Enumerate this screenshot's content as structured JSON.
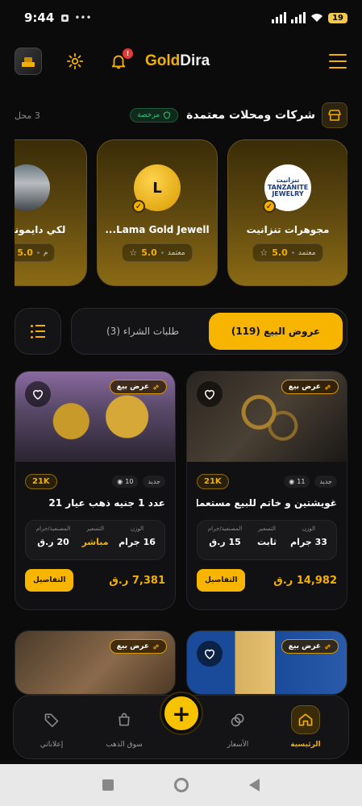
{
  "status": {
    "time": "9:44",
    "battery": "19"
  },
  "header": {
    "brand_gold": "Gold",
    "brand_rest": "Dira",
    "notification_count": "!"
  },
  "stores_section": {
    "title": "شركات ومحلات معتمدة",
    "licensed_badge": "مرخصة",
    "count": "3 محل"
  },
  "stores": [
    {
      "name": "مجوهرات تنزانيت",
      "logo_text": "تنزانيت TANZANITE JEWELRY",
      "rating": "5.0",
      "status": "معتمد"
    },
    {
      "name": "Lama Gold Jewell...",
      "logo_text": "L",
      "rating": "5.0",
      "status": "معتمد"
    },
    {
      "name": "لكي دايموند الف",
      "logo_text": "",
      "rating": "5.0",
      "status": "م"
    }
  ],
  "tabs": {
    "sale": "عروض البيع (119)",
    "buy": "طلبات الشراء (3)"
  },
  "labels": {
    "sale_badge": "عرض بيع",
    "new_tag": "جديد",
    "weight": "الوزن",
    "pricing": "التسعير",
    "workmanship": "المصنعية/جرام",
    "details": "التفاصيل"
  },
  "listings": [
    {
      "title": "غويشتين و خاتم للبيع مستعمل ب...",
      "views": "11",
      "karat": "21K",
      "weight": "33 جرام",
      "pricing": "ثابت",
      "pricing_highlight": false,
      "workmanship": "15 ر.ق",
      "price": "14,982 ر.ق"
    },
    {
      "title": "عدد 1 جنيه ذهب عيار 21",
      "views": "10",
      "karat": "21K",
      "weight": "16 جرام",
      "pricing": "مباشر",
      "pricing_highlight": true,
      "workmanship": "20 ر.ق",
      "price": "7,381 ر.ق"
    },
    {
      "title": "",
      "views": "",
      "karat": "",
      "weight": "",
      "pricing": "",
      "workmanship": "",
      "price": ""
    },
    {
      "title": "",
      "views": "",
      "karat": "",
      "weight": "",
      "pricing": "",
      "workmanship": "",
      "price": ""
    }
  ],
  "bottom_nav": [
    {
      "label": "الرئيسية",
      "icon": "home-icon",
      "active": true
    },
    {
      "label": "الأسعار",
      "icon": "prices-icon",
      "active": false
    },
    {
      "label": "سوق الذهب",
      "icon": "shopping-bag-icon",
      "active": false
    },
    {
      "label": "إعلاناتي",
      "icon": "tag-icon",
      "active": false
    }
  ],
  "fab_label": "+",
  "colors": {
    "accent": "#f7b500",
    "background": "#0b0b0c",
    "card": "#111113",
    "verified_green": "#34c27a"
  }
}
